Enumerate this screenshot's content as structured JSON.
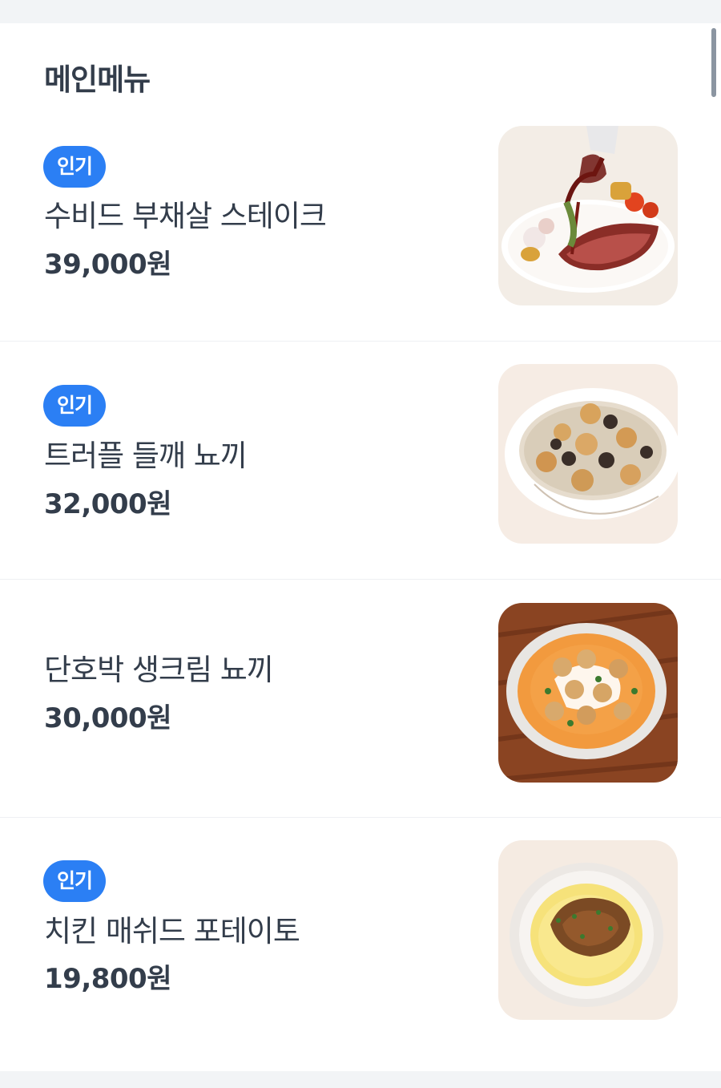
{
  "section": {
    "title": "메인메뉴"
  },
  "menu": [
    {
      "badge": "인기",
      "name": "수비드 부채살 스테이크",
      "price": "39,000원",
      "image": "steak-plate-image"
    },
    {
      "badge": "인기",
      "name": "트러플 들깨 뇨끼",
      "price": "32,000원",
      "image": "truffle-gnocchi-image"
    },
    {
      "badge": "",
      "name": "단호박 생크림 뇨끼",
      "price": "30,000원",
      "image": "pumpkin-gnocchi-image"
    },
    {
      "badge": "인기",
      "name": "치킨 매쉬드 포테이토",
      "price": "19,800원",
      "image": "chicken-mashed-potato-image"
    }
  ],
  "colors": {
    "badge": "#2b7ff4",
    "text": "#333d4b",
    "background": "#f2f4f6",
    "card": "#ffffff"
  }
}
